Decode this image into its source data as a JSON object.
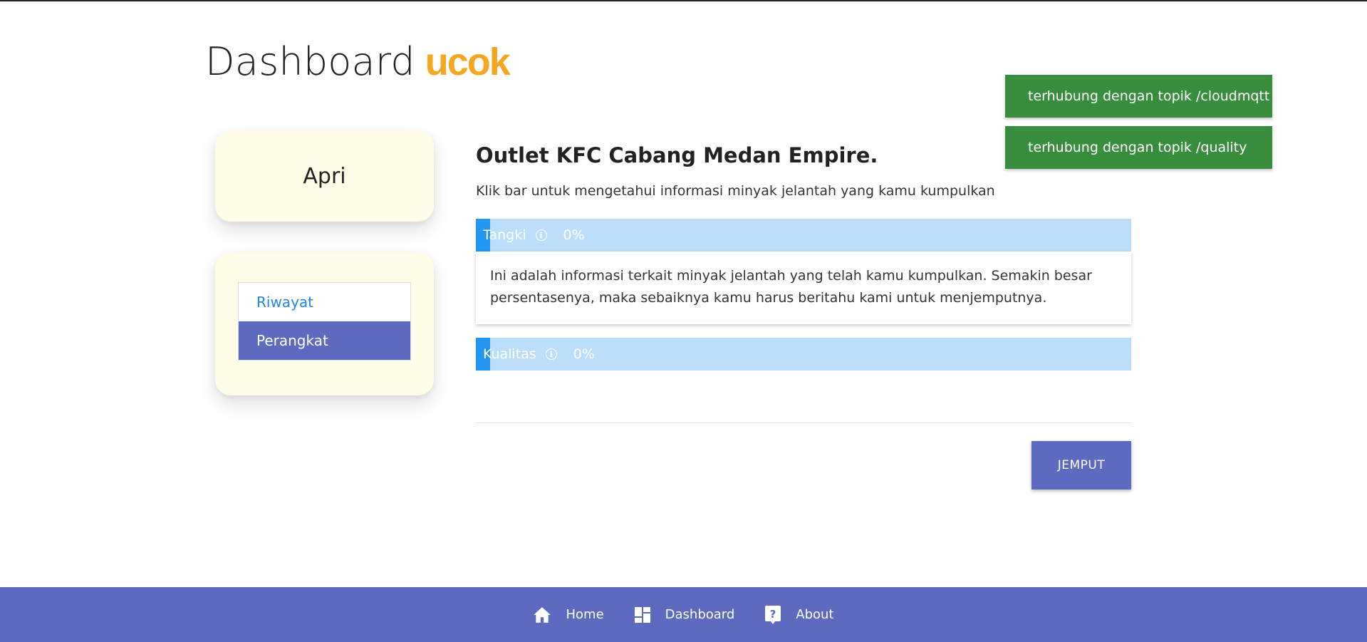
{
  "header": {
    "title": "Dashboard",
    "brand": "ucok",
    "brand_color": "#f5a623"
  },
  "notifications": [
    {
      "text": "terhubung dengan topik /cloudmqtt"
    },
    {
      "text": "terhubung dengan topik /quality"
    }
  ],
  "sidebar": {
    "user_name": "Apri",
    "menu": [
      {
        "label": "Riwayat",
        "active": false
      },
      {
        "label": "Perangkat",
        "active": true
      }
    ]
  },
  "main": {
    "outlet_title": "Outlet KFC Cabang Medan Empire.",
    "subtitle": "Klik bar untuk mengetahui informasi minyak jelantah yang kamu kumpulkan",
    "bars": [
      {
        "label": "Tangki",
        "percent_text": "0%",
        "value": 0,
        "icon": "info-icon"
      },
      {
        "label": "Kualitas",
        "percent_text": "0%",
        "value": 0,
        "icon": "info-icon"
      }
    ],
    "info_text": "Ini adalah informasi terkait minyak jelantah yang telah kamu kumpulkan. Semakin besar persentasenya, maka sebaiknya kamu harus beritahu kami untuk menjemputnya.",
    "action_button": "JEMPUT"
  },
  "bottom_nav": [
    {
      "label": "Home",
      "icon": "home-icon"
    },
    {
      "label": "Dashboard",
      "icon": "dashboard-icon"
    },
    {
      "label": "About",
      "icon": "help-icon"
    }
  ],
  "colors": {
    "primary": "#5c6bc0",
    "success": "#388e3c",
    "bar_track": "#bbdefb",
    "bar_fill": "#2196f3",
    "card_bg": "#fffde7"
  }
}
